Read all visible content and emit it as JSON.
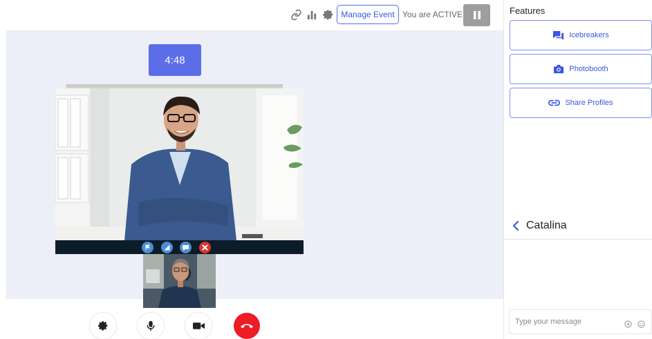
{
  "topbar": {
    "icons": [
      "link-icon",
      "bar-chart-icon",
      "gear-icon"
    ],
    "manage_event_label": "Manage Event",
    "status_text": "You are ACTIVE",
    "pause_icon": "pause-icon"
  },
  "stage": {
    "timer": "4:48",
    "call_controls": [
      {
        "icon": "flag-icon",
        "color": "#4a8fd6"
      },
      {
        "icon": "signal-icon",
        "color": "#4a8fd6"
      },
      {
        "icon": "chat-icon",
        "color": "#4a8fd6"
      },
      {
        "icon": "close-icon",
        "color": "#e03131"
      }
    ]
  },
  "bottom_controls": [
    {
      "icon": "gear-icon"
    },
    {
      "icon": "microphone-icon"
    },
    {
      "icon": "video-camera-icon"
    },
    {
      "icon": "hang-up-icon",
      "color": "#ee1c24"
    }
  ],
  "features": {
    "title": "Features",
    "items": [
      {
        "label": "Icebreakers",
        "icon": "chat-bubbles-icon"
      },
      {
        "label": "Photobooth",
        "icon": "camera-icon"
      },
      {
        "label": "Share Profiles",
        "icon": "link-icon"
      }
    ]
  },
  "chat": {
    "back_icon": "chevron-left-icon",
    "name": "Catalina",
    "input_value": "",
    "input_placeholder": "Type your message",
    "icons": [
      "add-circle-icon",
      "emoji-icon"
    ]
  },
  "colors": {
    "accent": "#5b6ee8",
    "stage_background": "#eceef8",
    "hangup": "#ee1c24"
  }
}
